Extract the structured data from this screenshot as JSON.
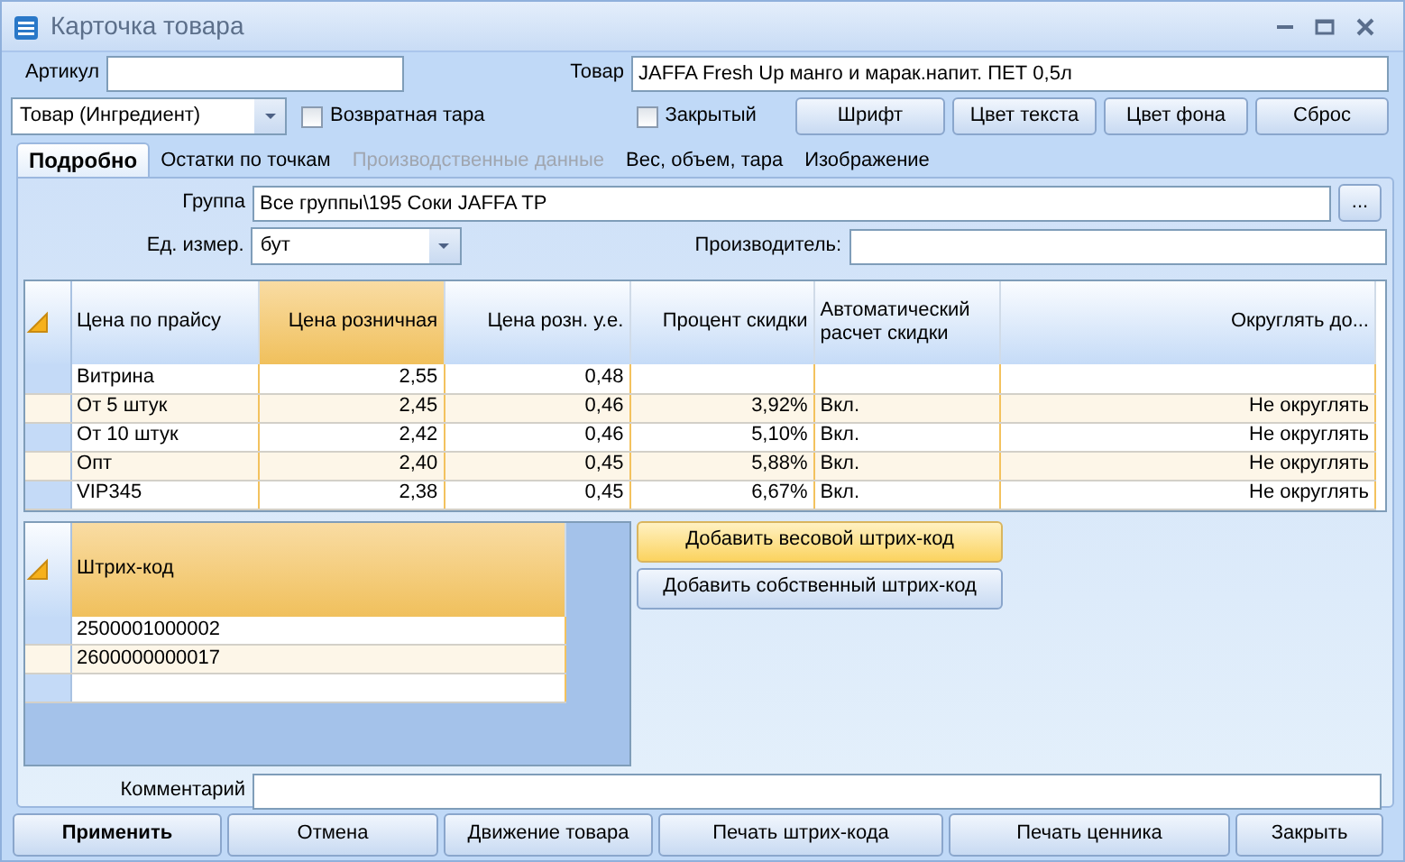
{
  "window": {
    "title": "Карточка товара"
  },
  "article": {
    "label": "Артикул"
  },
  "product": {
    "label": "Товар",
    "value": "JAFFA Fresh Up манго и марак.напит. ПЕТ 0,5л"
  },
  "type_combo": {
    "value": "Товар (Ингредиент)"
  },
  "checkboxes": [
    {
      "label": "Возвратная тара",
      "checked": false
    },
    {
      "label": "Закрытый",
      "checked": false
    }
  ],
  "style_buttons": [
    "Шрифт",
    "Цвет текста",
    "Цвет фона",
    "Сброс"
  ],
  "tabs": [
    {
      "label": "Подробно",
      "selected": true,
      "disabled": false
    },
    {
      "label": "Остатки по точкам",
      "selected": false,
      "disabled": false
    },
    {
      "label": "Производственные данные",
      "selected": false,
      "disabled": true
    },
    {
      "label": "Вес, объем, тара",
      "selected": false,
      "disabled": false
    },
    {
      "label": "Изображение",
      "selected": false,
      "disabled": false
    }
  ],
  "group": {
    "label": "Группа",
    "value": "Все группы\\195 Соки JAFFA TP",
    "browse": "..."
  },
  "unit": {
    "label": "Ед. измер.",
    "value": "бут"
  },
  "manufacturer": {
    "label": "Производитель:"
  },
  "price_table": {
    "columns": [
      {
        "label": "Цена по прайсу",
        "kind": "text",
        "sorted": false
      },
      {
        "label": "Цена розничная",
        "kind": "number",
        "sorted": true
      },
      {
        "label": "Цена розн. у.е.",
        "kind": "number",
        "sorted": false
      },
      {
        "label": "Процент скидки",
        "kind": "number",
        "sorted": false
      },
      {
        "label": "Автоматический расчет скидки",
        "kind": "text",
        "sorted": false
      },
      {
        "label": "Округлять до...",
        "kind": "number",
        "sorted": false
      }
    ],
    "rows": [
      [
        "Витрина",
        "2,55",
        "0,48",
        null,
        null,
        null
      ],
      [
        "От 5 штук",
        "2,45",
        "0,46",
        "3,92%",
        "Вкл.",
        "Не округлять"
      ],
      [
        "От 10 штук",
        "2,42",
        "0,46",
        "5,10%",
        "Вкл.",
        "Не округлять"
      ],
      [
        "Опт",
        "2,40",
        "0,45",
        "5,88%",
        "Вкл.",
        "Не округлять"
      ],
      [
        "VIP345",
        "2,38",
        "0,45",
        "6,67%",
        "Вкл.",
        "Не округлять"
      ]
    ]
  },
  "barcode_table": {
    "columns": [
      {
        "label": "Штрих-код",
        "sorted": true
      }
    ],
    "rows": [
      [
        "2500001000002"
      ],
      [
        "2600000000017"
      ]
    ]
  },
  "barcode_buttons": [
    {
      "label": "Добавить весовой штрих-код",
      "highlighted": true
    },
    {
      "label": "Добавить собственный штрих-код",
      "highlighted": false
    }
  ],
  "comment": {
    "label": "Комментарий"
  },
  "bottom_buttons": [
    {
      "label": "Применить",
      "default": true
    },
    {
      "label": "Отмена",
      "default": false
    },
    {
      "label": "Движение товара",
      "default": false
    },
    {
      "label": "Печать штрих-кода",
      "default": false
    },
    {
      "label": "Печать ценника",
      "default": false
    },
    {
      "label": "Закрыть",
      "default": false
    }
  ]
}
